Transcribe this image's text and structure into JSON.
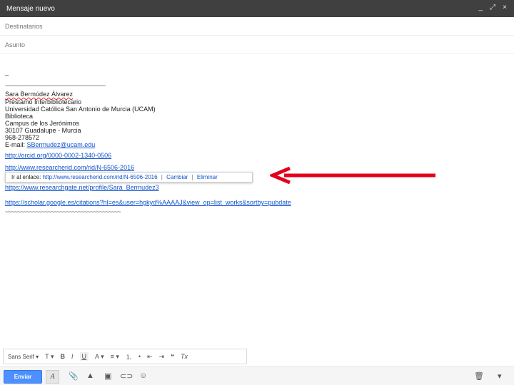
{
  "window": {
    "title": "Mensaje nuevo",
    "controls": [
      "_",
      "⤢",
      "×"
    ]
  },
  "fields": {
    "to_placeholder": "Destinatarios",
    "subject_placeholder": "Asunto"
  },
  "signature": {
    "dash": "–",
    "tilde_top": "~~~~~~~~~~~~~~~~~~~~~~~~~~~~~~~~~",
    "name": "Sara Bermúdez Álvarez",
    "role": "Préstamo Interbibliotecario",
    "university": "Universidad Católica San Antonio de Murcia (UCAM)",
    "department": "Biblioteca",
    "campus": "Campus de los Jerónimos",
    "postal": "30107 Guadalupe - Murcia",
    "phone": "968-278572",
    "email_label": "E-mail:",
    "email": "SBermudez@ucam.edu",
    "orcid": "http://orcid.org/0000-0002-1340-0506",
    "researcherid": "http://www.researcherid.com/rid/N-6506-2016",
    "researchgate": "https://www.researchgate.net/profile/Sara_Bermudez3",
    "scholar": "https://scholar.google.es/citations?hl=es&user=hgkyd%AAAAJ&view_op=list_works&sortby=pubdate",
    "tilde_bottom": "~~~~~~~~~~~~~~~~~~~~~~~~~~~~~~~~~~~~~~"
  },
  "link_popup": {
    "label": "Ir al enlace:",
    "url": "http://www.researcherid.com/rid/N-6506-2016",
    "change": "Cambiar",
    "remove": "Eliminar",
    "separator": "|"
  },
  "format_toolbar": {
    "font": "Sans Serif",
    "size_icon": "T",
    "bold": "B",
    "italic": "I",
    "underline": "U",
    "text_color": "A",
    "align": "≡",
    "numbered": "⒈",
    "bullets": "•",
    "indent_less": "⇤",
    "indent_more": "⇥",
    "quote": "❝",
    "clear": "Tx"
  },
  "bottom_bar": {
    "send": "Enviar",
    "format_toggle": "A",
    "attach": "📎",
    "drive": "▲",
    "photo": "▣",
    "link": "⊂⊃",
    "emoji": "☺",
    "trash": "🗑",
    "more": "▾"
  },
  "colors": {
    "titlebar": "#404040",
    "link": "#1155cc",
    "send": "#4d90fe",
    "arrow": "#e3001b"
  }
}
